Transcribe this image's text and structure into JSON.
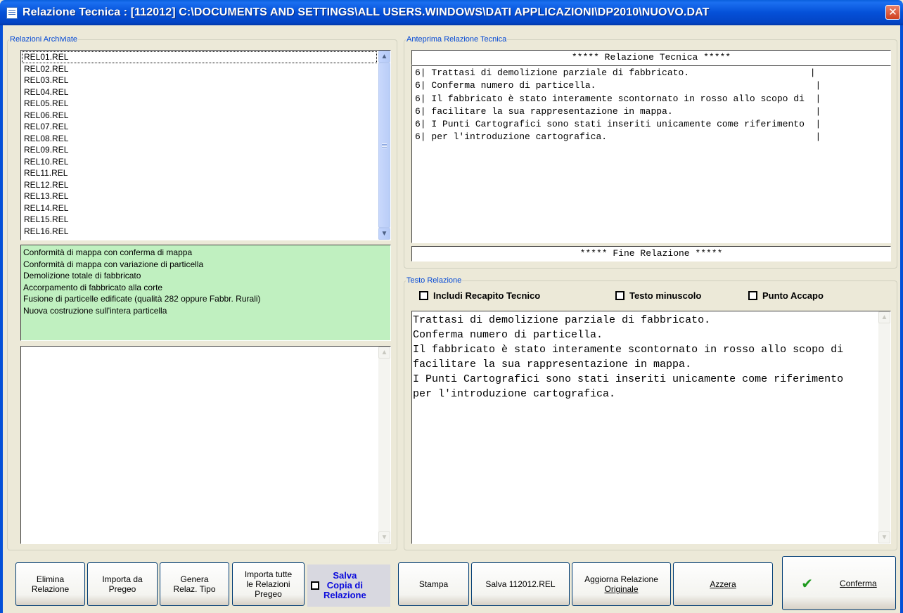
{
  "window": {
    "title": "Relazione Tecnica : [112012] C:\\DOCUMENTS AND SETTINGS\\ALL USERS.WINDOWS\\DATI APPLICAZIONI\\DP2010\\NUOVO.DAT",
    "close_glyph": "✕"
  },
  "archived": {
    "legend": "Relazioni Archiviate",
    "items": [
      "REL01.REL",
      "REL02.REL",
      "REL03.REL",
      "REL04.REL",
      "REL05.REL",
      "REL06.REL",
      "REL07.REL",
      "REL08.REL",
      "REL09.REL",
      "REL10.REL",
      "REL11.REL",
      "REL12.REL",
      "REL13.REL",
      "REL14.REL",
      "REL15.REL",
      "REL16.REL"
    ],
    "selected_index": 0
  },
  "templates": {
    "items": [
      "Conformità di mappa con conferma di mappa",
      "Conformità di mappa con variazione di particella",
      "Demolizione totale di fabbricato",
      "Accorpamento di fabbricato alla corte",
      "Fusione di particelle edificate (qualità 282 oppure Fabbr. Rurali)",
      "Nuova costruzione sull'intera particella"
    ]
  },
  "preview": {
    "legend": "Anteprima Relazione Tecnica",
    "header": "***** Relazione  Tecnica *****",
    "lines": [
      "6| Trattasi di demolizione parziale di fabbricato.                      |",
      "6| Conferma numero di particella.                                        |",
      "6| Il fabbricato è stato interamente scontornato in rosso allo scopo di  |",
      "6| facilitare la sua rappresentazione in mappa.                          |",
      "6| I Punti Cartografici sono stati inseriti unicamente come riferimento  |",
      "6| per l'introduzione cartografica.                                      |"
    ],
    "footer": "*****   Fine   Relazione *****"
  },
  "testo": {
    "legend": "Testo Relazione",
    "check_recapito": "Includi Recapito Tecnico",
    "check_minuscolo": "Testo minuscolo",
    "check_accapo": "Punto Accapo",
    "text": "Trattasi di demolizione parziale di fabbricato.\nConferma numero di particella.\nIl fabbricato è stato interamente scontornato in rosso allo scopo di\nfacilitare la sua rappresentazione in mappa.\nI Punti Cartografici sono stati inseriti unicamente come riferimento\nper l'introduzione cartografica."
  },
  "buttons": {
    "elimina_1": "Elimina",
    "elimina_2": "Relazione",
    "importa_1": "Importa da",
    "importa_2": "Pregeo",
    "genera_1": "Genera",
    "genera_2": "Relaz. Tipo",
    "importa_tutte_1": "Importa tutte",
    "importa_tutte_2": "le Relazioni",
    "importa_tutte_3": "Pregeo",
    "salva_copia_1": "Salva",
    "salva_copia_2": "Copia di",
    "salva_copia_3": "Relazione",
    "stampa": "Stampa",
    "salva_file": "Salva 112012.REL",
    "aggiorna_1": "Aggiorna Relazione",
    "aggiorna_2": "Originale",
    "azzera": "Azzera",
    "conferma": "Conferma"
  },
  "colors": {
    "titlebar": "#0450d8",
    "templates_bg": "#c0f0c0",
    "legend_text": "#0046d5",
    "salva_copia_text": "#0a0adc",
    "confirm_check": "#1e9a1e"
  },
  "icons": {
    "window": "notepad-icon",
    "close": "close-icon",
    "confirm": "checkmark-icon"
  }
}
